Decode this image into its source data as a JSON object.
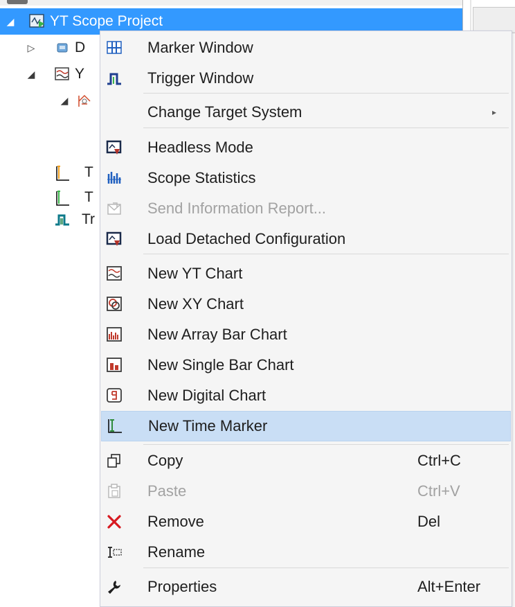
{
  "tree": {
    "project_label": "YT Scope Project",
    "items": [
      {
        "label": "D"
      },
      {
        "label": "Y"
      },
      {
        "label": "T"
      },
      {
        "label": "T"
      },
      {
        "label": "Tr"
      }
    ]
  },
  "menu": {
    "items": [
      {
        "label": "Marker Window",
        "icon": "marker-window-icon"
      },
      {
        "label": "Trigger Window",
        "icon": "trigger-window-icon"
      },
      {
        "label": "Change Target System",
        "icon": "",
        "submenu": true
      },
      {
        "label": "Headless Mode",
        "icon": "headless-mode-icon"
      },
      {
        "label": "Scope Statistics",
        "icon": "scope-statistics-icon"
      },
      {
        "label": "Send Information Report...",
        "icon": "send-report-icon",
        "disabled": true
      },
      {
        "label": "Load Detached Configuration",
        "icon": "load-detached-config-icon"
      },
      {
        "label": "New YT Chart",
        "icon": "yt-chart-icon"
      },
      {
        "label": "New XY Chart",
        "icon": "xy-chart-icon"
      },
      {
        "label": "New Array Bar Chart",
        "icon": "array-bar-chart-icon"
      },
      {
        "label": "New Single Bar Chart",
        "icon": "single-bar-chart-icon"
      },
      {
        "label": "New Digital Chart",
        "icon": "digital-chart-icon"
      },
      {
        "label": "New Time Marker",
        "icon": "time-marker-icon",
        "highlighted": true
      },
      {
        "label": "Copy",
        "shortcut": "Ctrl+C",
        "icon": "copy-icon"
      },
      {
        "label": "Paste",
        "shortcut": "Ctrl+V",
        "icon": "paste-icon",
        "disabled": true
      },
      {
        "label": "Remove",
        "shortcut": "Del",
        "icon": "remove-icon"
      },
      {
        "label": "Rename",
        "icon": "rename-icon"
      },
      {
        "label": "Properties",
        "shortcut": "Alt+Enter",
        "icon": "properties-icon"
      }
    ],
    "submenu_arrow": "▸"
  },
  "colors": {
    "selection": "#3399ff",
    "menu_background": "#f5f5f5",
    "highlight": "#c9def5",
    "disabled_text": "#a2a2a2",
    "remove_red": "#d71920"
  }
}
